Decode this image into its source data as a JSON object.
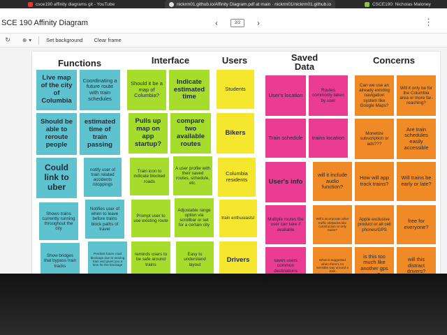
{
  "browser_tabs": [
    {
      "label": "csce190 affinity diagrams git - YouTube",
      "icon": "youtube-icon"
    },
    {
      "label": "nickrm01.github.io/Affinity Diagram.pdf at main · nickrm01/nickrm01.github.io",
      "icon": "github-icon"
    },
    {
      "label": "CSCE190: Nicholas Maloney",
      "icon": "app-icon"
    }
  ],
  "app": {
    "title": "SCE 190 Affinity Diagram",
    "page_indicator": "2/2",
    "prev_icon": "‹",
    "next_icon": "›",
    "menu_icon": "⋮"
  },
  "toolbar": {
    "undo_icon": "↻",
    "zoom_icon": "⊕",
    "zoom_caret": "▾",
    "set_background": "Set background",
    "clear_frame": "Clear frame"
  },
  "board": {
    "headers": {
      "functions": "Functions",
      "interface": "Interface",
      "users": "Users",
      "saved_data_1": "Saved",
      "saved_data_2": "Data",
      "concerns": "Concerns"
    },
    "functions": [
      "Live map of the city of Columbia",
      "Coordinating a future route with train schedules",
      "Should be able to reroute people",
      "estimated time of train passing",
      "Could link to uber",
      "notify user of train related accidents /stoppings",
      "Shows trains currently running throughout the city",
      "Notifies user of when to leave before trains block paths of travel",
      "Show bridges that bypass train tracks",
      "Predicts future road blockage due to moving train and gives you a time for the blockage"
    ],
    "interface": [
      "Should it be a map of Columbia?",
      "Indicate estimated time",
      "Pulls up map on app startup?",
      "compare two available routes",
      "Train icon to indicate blocked roads",
      "A user profile with their saved routes, schedule, etc.",
      "Prompt user to use existing route",
      "Adjustable range option via scrollbar or set for a certain city",
      "reminds users to be safe around trains",
      "Easy to understand layout"
    ],
    "users": [
      "Students",
      "Bikers",
      "Columbia residents",
      "train enthusiasts!",
      "Drivers"
    ],
    "saved_data": [
      "User's location",
      "Routes commonly taken by user",
      "Train schedule",
      "trains location",
      "User's info",
      "Multiple routes the user can take if available",
      "saves users common destinations"
    ],
    "concerns": [
      "Can we use an already existing navigation system like Google Maps?",
      "Will it only be for the Columbia area or more far-reaching?",
      "Monetize subscription or ads???",
      "Are train schedules easily accessible",
      "will it include audio function?",
      "How will app track trains?",
      "Will trains be early or late?",
      "Will it incorporate other traffic obstacles like construction or only trains?",
      "Apple exclusive product or all cell phones/GPS",
      "free for everyone?",
      "What is suggested when there's no sensible way around a train",
      "is this too much like another gps app?",
      "will this distract drivers?"
    ]
  }
}
